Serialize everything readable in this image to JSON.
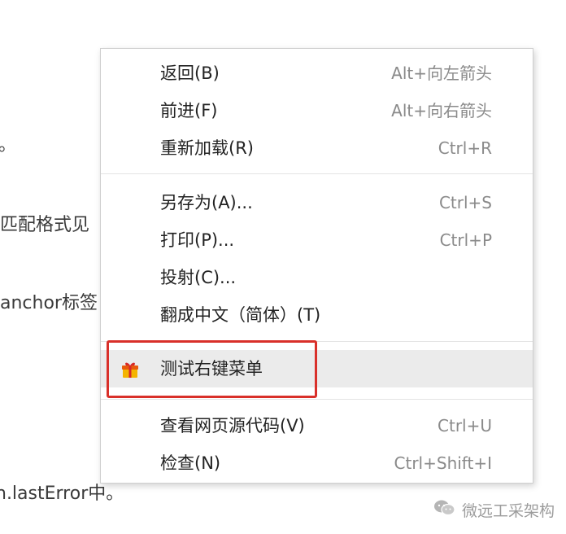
{
  "background": {
    "fragments": [
      "。",
      "匹配格式见",
      "anchor标签",
      "n.lastError中。"
    ]
  },
  "menu": {
    "groups": [
      [
        {
          "label": "返回(B)",
          "shortcut": "Alt+向左箭头"
        },
        {
          "label": "前进(F)",
          "shortcut": "Alt+向右箭头"
        },
        {
          "label": "重新加载(R)",
          "shortcut": "Ctrl+R"
        }
      ],
      [
        {
          "label": "另存为(A)...",
          "shortcut": "Ctrl+S"
        },
        {
          "label": "打印(P)...",
          "shortcut": "Ctrl+P"
        },
        {
          "label": "投射(C)...",
          "shortcut": ""
        },
        {
          "label": "翻成中文（简体）(T)",
          "shortcut": ""
        }
      ],
      [
        {
          "label": "测试右键菜单",
          "shortcut": "",
          "icon": "gift-icon",
          "highlighted": true
        }
      ],
      [
        {
          "label": "查看网页源代码(V)",
          "shortcut": "Ctrl+U"
        },
        {
          "label": "检查(N)",
          "shortcut": "Ctrl+Shift+I"
        }
      ]
    ]
  },
  "annotation": {
    "color": "#d9302a"
  },
  "watermark": {
    "text": "微远工采架构",
    "icon": "wechat-icon"
  }
}
